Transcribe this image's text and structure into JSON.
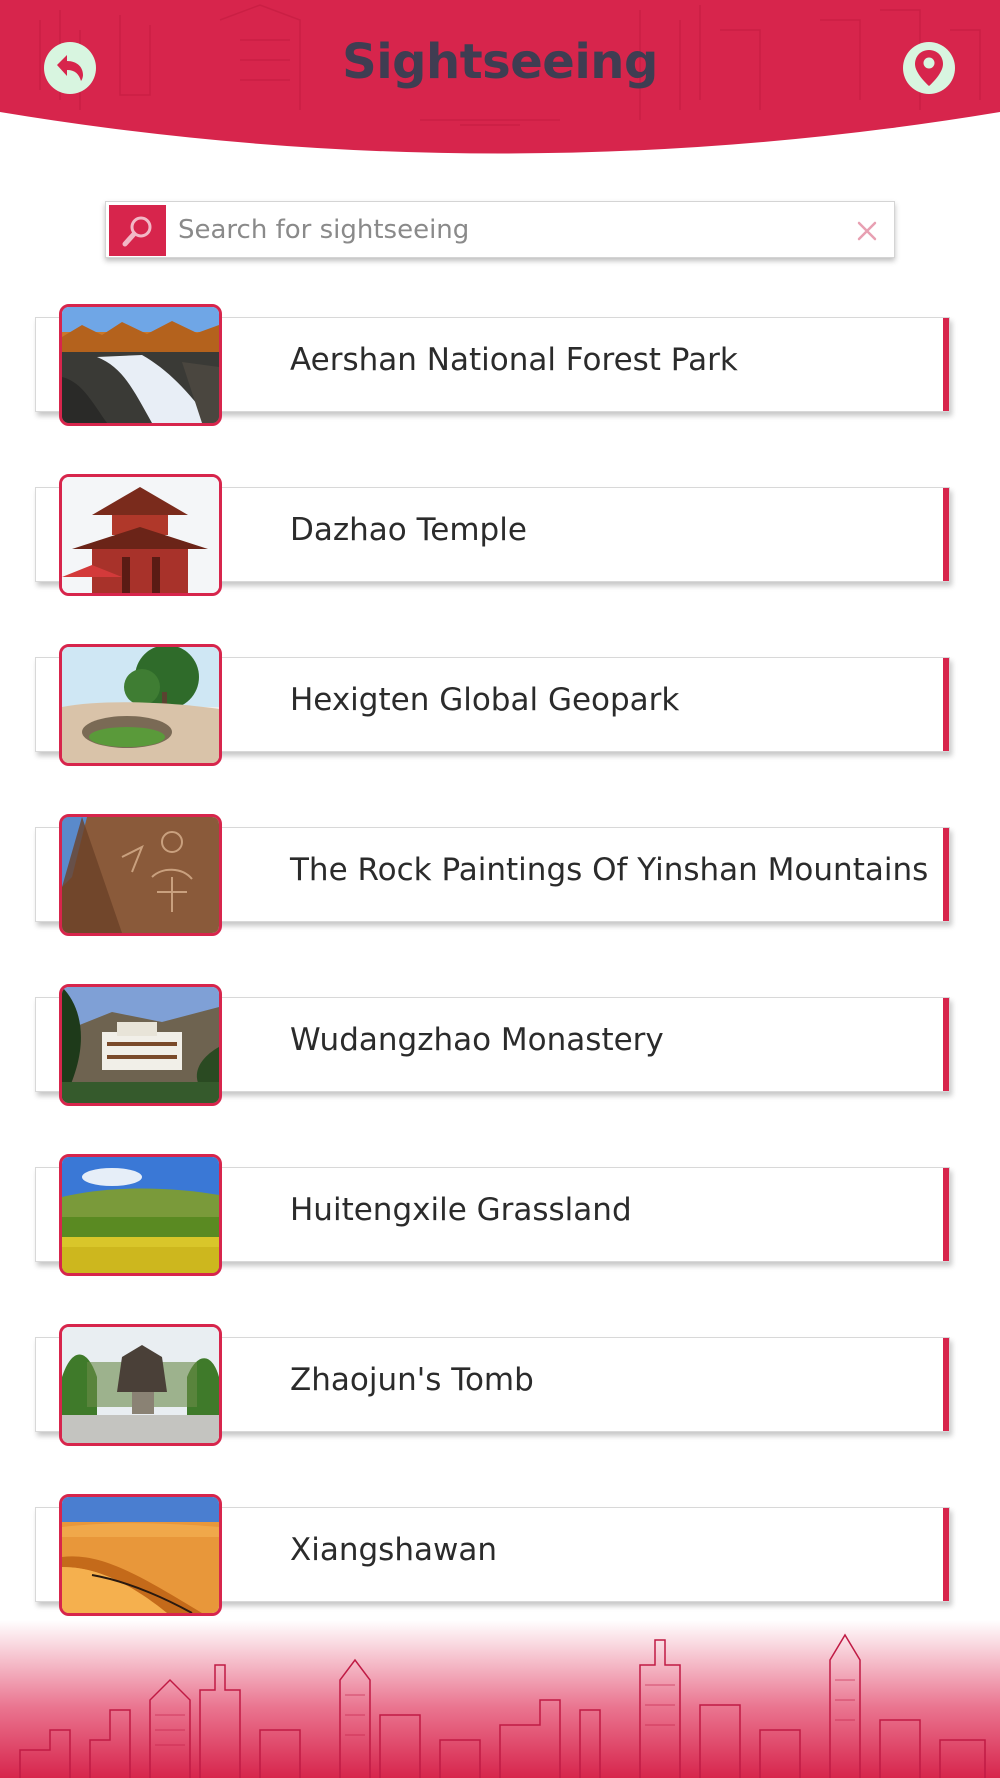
{
  "header": {
    "title": "Sightseeing",
    "back_icon": "back-arrow-icon",
    "location_icon": "map-pin-icon",
    "brand_color": "#d7254c",
    "title_color": "#3f3d52",
    "button_color": "#d8f5e0"
  },
  "search": {
    "placeholder": "Search for sightseeing",
    "value": "",
    "search_icon": "search-icon",
    "clear_icon": "close-icon"
  },
  "places": [
    {
      "name": "Aershan National Forest Park",
      "image": "waterfall-forest"
    },
    {
      "name": "Dazhao Temple",
      "image": "pagoda"
    },
    {
      "name": "Hexigten Global Geopark",
      "image": "rock-pool-trees"
    },
    {
      "name": "The Rock Paintings Of Yinshan Mountains",
      "image": "rock-carvings"
    },
    {
      "name": "Wudangzhao Monastery",
      "image": "hillside-monastery"
    },
    {
      "name": "Huitengxile Grassland",
      "image": "grassland-flowers"
    },
    {
      "name": "Zhaojun's Tomb",
      "image": "horse-statue"
    },
    {
      "name": "Xiangshawan",
      "image": "sand-dunes"
    }
  ],
  "footer": {
    "decoration": "city-skyline-sketch"
  }
}
